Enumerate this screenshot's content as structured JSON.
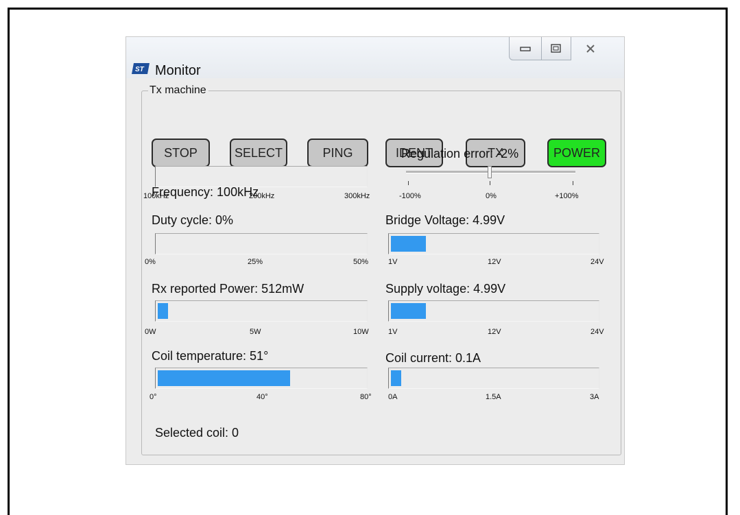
{
  "window": {
    "title": "Monitor",
    "app_icon": "st-logo-icon"
  },
  "title_controls": {
    "minimize_icon": "minimize-icon",
    "maximize_icon": "maximize-icon",
    "close_icon": "close-icon"
  },
  "group": {
    "label": "Tx machine"
  },
  "states": [
    {
      "label": "STOP",
      "active": false
    },
    {
      "label": "SELECT",
      "active": false
    },
    {
      "label": "PING",
      "active": false
    },
    {
      "label": "IDENT",
      "active": false
    },
    {
      "label": "TX",
      "active": false
    },
    {
      "label": "POWER",
      "active": true
    }
  ],
  "colors": {
    "active_state": "#22e022",
    "inactive_state": "#c6c6c6",
    "bar_fill": "#3399ef"
  },
  "frequency": {
    "label": "Frequency:  100kHz",
    "level": 0,
    "ticks": [
      "100kHz",
      "200kHz",
      "300kHz"
    ]
  },
  "regulation": {
    "label": "Regulation error:  -2%",
    "value_percent": -2,
    "ticks": [
      "-100%",
      "0%",
      "+100%"
    ]
  },
  "duty": {
    "label": "Duty cycle:  0%",
    "level": 0,
    "ticks": [
      "0%",
      "25%",
      "50%"
    ]
  },
  "bridge": {
    "label": "Bridge Voltage:  4.99V",
    "level": 0.17,
    "ticks": [
      "1V",
      "12V",
      "24V"
    ]
  },
  "rx_power": {
    "label": "Rx reported Power: 512mW",
    "level": 0.051,
    "ticks": [
      "0W",
      "5W",
      "10W"
    ]
  },
  "supply": {
    "label": "Supply voltage: 4.99V",
    "level": 0.17,
    "ticks": [
      "1V",
      "12V",
      "24V"
    ]
  },
  "coil_temp": {
    "label": "Coil temperature:  51°",
    "level": 0.64,
    "ticks": [
      "0°",
      "40°",
      "80°"
    ]
  },
  "coil_current": {
    "label": "Coil current:  0.1A",
    "level": 0.05,
    "ticks": [
      "0A",
      "1.5A",
      "3A"
    ]
  },
  "selected_coil": {
    "label": "Selected coil:  0"
  }
}
